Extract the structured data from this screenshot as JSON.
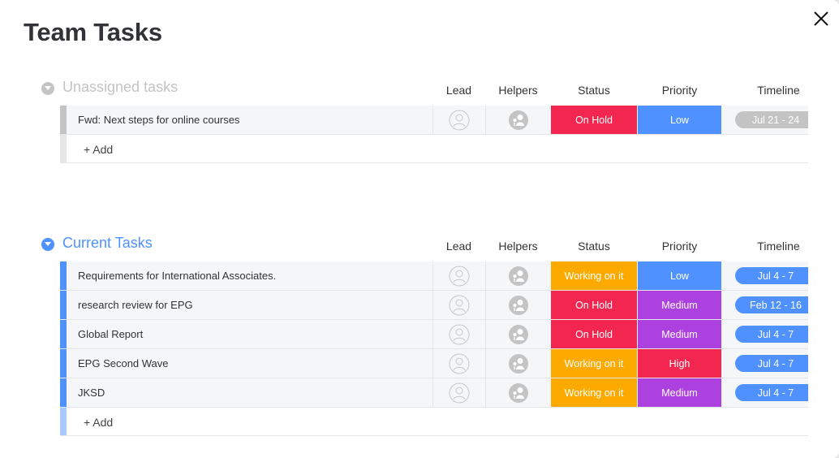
{
  "title": "Team Tasks",
  "columns": [
    "Lead",
    "Helpers",
    "Status",
    "Priority",
    "Timeline"
  ],
  "colors": {
    "on_hold": "#f2264f",
    "working": "#fdaa00",
    "low": "#4f92ff",
    "medium": "#ad41e0",
    "high": "#f2264f",
    "timeline_active": "#4f92ff",
    "timeline_inactive": "#c4c4c4",
    "group_unassigned": "#c4c4c4",
    "group_current": "#4f92ff"
  },
  "groups": [
    {
      "title": "Unassigned tasks",
      "add_label": "+ Add",
      "tasks": [
        {
          "name": "Fwd: Next steps for online courses",
          "status": "On Hold",
          "priority": "Low",
          "timeline": "Jul 21 - 24"
        }
      ]
    },
    {
      "title": "Current Tasks",
      "add_label": "+ Add",
      "tasks": [
        {
          "name": "Requirements for International Associates.",
          "status": "Working on it",
          "priority": "Low",
          "timeline": "Jul 4 - 7"
        },
        {
          "name": "research review for EPG",
          "status": "On Hold",
          "priority": "Medium",
          "timeline": "Feb 12 - 16"
        },
        {
          "name": "Global Report",
          "status": "On Hold",
          "priority": "Medium",
          "timeline": "Jul 4 - 7"
        },
        {
          "name": "EPG Second Wave",
          "status": "Working on it",
          "priority": "High",
          "timeline": "Jul 4 - 7"
        },
        {
          "name": "JKSD",
          "status": "Working on it",
          "priority": "Medium",
          "timeline": "Jul 4 - 7"
        }
      ]
    }
  ]
}
